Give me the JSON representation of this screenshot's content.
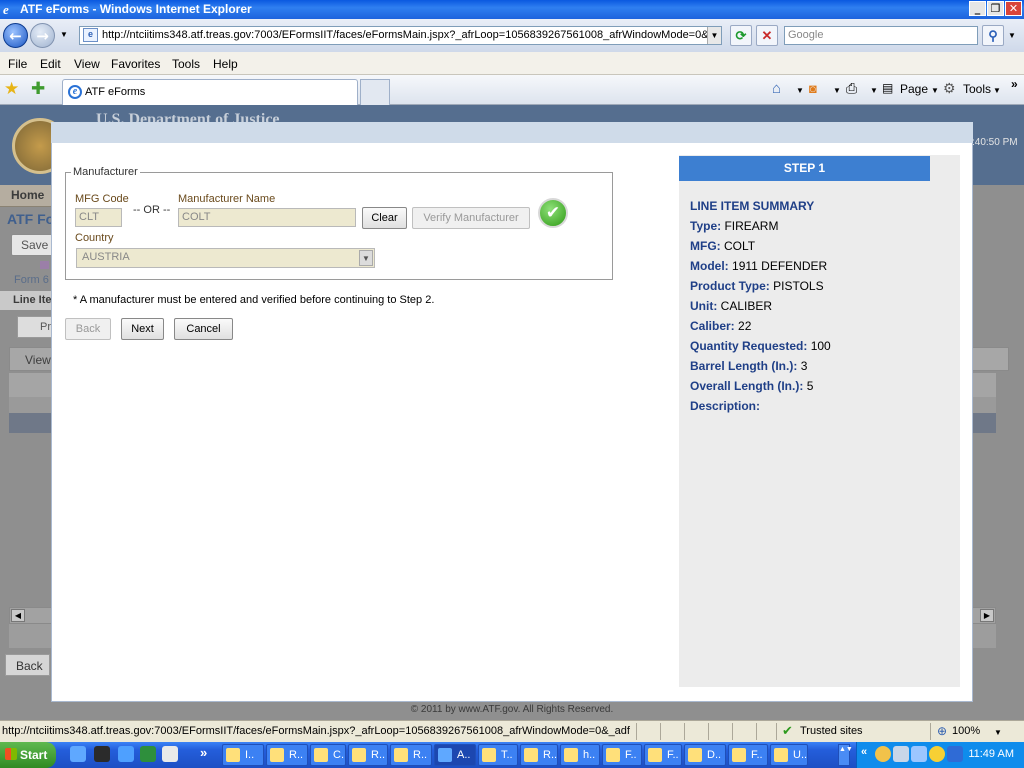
{
  "window": {
    "title": "ATF eForms - Windows Internet Explorer",
    "address": "http://ntciitims348.atf.treas.gov:7003/EFormsIIT/faces/eFormsMain.jspx?_afrLoop=1056839267561008_afrWindowMode=0&",
    "search_placeholder": "Google"
  },
  "menu": [
    "File",
    "Edit",
    "View",
    "Favorites",
    "Tools",
    "Help"
  ],
  "tab": {
    "label": "ATF eForms"
  },
  "command_bar": {
    "page_label": "Page",
    "tools_label": "Tools"
  },
  "background": {
    "header_text": "U.S. Department of Justice",
    "clock": ":40:50 PM",
    "home_label": "Home",
    "app_title": "ATF Fo",
    "save_label": "Save",
    "form_link": "Form 6",
    "line_item_label": "Line Ite",
    "pr_label": "Pr",
    "view_label": "View",
    "back_label": "Back",
    "footer": "© 2011 by www.ATF.gov. All Rights Reserved."
  },
  "dialog": {
    "legend": "Manufacturer",
    "mfg_code_label": "MFG Code",
    "or_label": "-- OR --",
    "mfg_name_label": "Manufacturer Name",
    "mfg_code_value": "CLT",
    "mfg_name_value": "COLT",
    "clear_label": "Clear",
    "verify_label": "Verify Manufacturer",
    "country_label": "Country",
    "country_value": "AUSTRIA",
    "note": "* A manufacturer must be entered and verified before continuing to Step 2.",
    "back_label": "Back",
    "next_label": "Next",
    "cancel_label": "Cancel"
  },
  "summary": {
    "step": "STEP 1",
    "title": "LINE ITEM SUMMARY",
    "rows": [
      {
        "label": "Type:",
        "value": "FIREARM"
      },
      {
        "label": "MFG:",
        "value": "COLT"
      },
      {
        "label": "Model:",
        "value": "1911 DEFENDER"
      },
      {
        "label": "Product Type:",
        "value": "PISTOLS"
      },
      {
        "label": "Unit:",
        "value": "CALIBER"
      },
      {
        "label": "Caliber:",
        "value": "22"
      },
      {
        "label": "Quantity Requested:",
        "value": "100"
      },
      {
        "label": "Barrel Length (In.):",
        "value": "3"
      },
      {
        "label": "Overall Length (In.):",
        "value": "5"
      },
      {
        "label": "Description:",
        "value": ""
      }
    ]
  },
  "statusbar": {
    "url": "http://ntciitims348.atf.treas.gov:7003/EFormsIIT/faces/eFormsMain.jspx?_afrLoop=1056839267561008_afrWindowMode=0&_adf",
    "zone": "Trusted sites",
    "zoom": "100%"
  },
  "taskbar": {
    "start_label": "Start",
    "time": "11:49 AM",
    "tasks": [
      "I..",
      "R..",
      "C..",
      "R..",
      "R..",
      "A..",
      "T..",
      "R..",
      "h..",
      "F..",
      "F..",
      "D..",
      "F..",
      "U.."
    ]
  },
  "colors": {
    "accent": "#3d7fd1",
    "summary_label": "#1f3f87",
    "field_label": "#6a4a1c"
  }
}
